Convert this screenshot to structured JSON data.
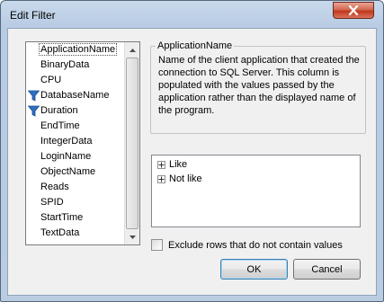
{
  "window": {
    "title": "Edit Filter"
  },
  "columns": [
    {
      "label": "ApplicationName",
      "filtered": false,
      "selected": true
    },
    {
      "label": "BinaryData",
      "filtered": false
    },
    {
      "label": "CPU",
      "filtered": false
    },
    {
      "label": "DatabaseName",
      "filtered": true
    },
    {
      "label": "Duration",
      "filtered": true
    },
    {
      "label": "EndTime",
      "filtered": false
    },
    {
      "label": "IntegerData",
      "filtered": false
    },
    {
      "label": "LoginName",
      "filtered": false
    },
    {
      "label": "ObjectName",
      "filtered": false
    },
    {
      "label": "Reads",
      "filtered": false
    },
    {
      "label": "SPID",
      "filtered": false
    },
    {
      "label": "StartTime",
      "filtered": false
    },
    {
      "label": "TextData",
      "filtered": false
    }
  ],
  "details": {
    "heading": "ApplicationName",
    "description": "Name of the client application that created the connection to SQL Server. This column is populated with the values passed by the application rather than the displayed name of the program."
  },
  "operators": [
    {
      "label": "Like",
      "expander": "+"
    },
    {
      "label": "Not like",
      "expander": "+"
    }
  ],
  "options": {
    "exclude_label": "Exclude rows that do not contain values",
    "exclude_checked": false
  },
  "buttons": {
    "ok": "OK",
    "cancel": "Cancel"
  },
  "colors": {
    "filter_icon": "#2f6fc4",
    "close_button": "#c1371c",
    "titlebar": "#b9cce2"
  }
}
